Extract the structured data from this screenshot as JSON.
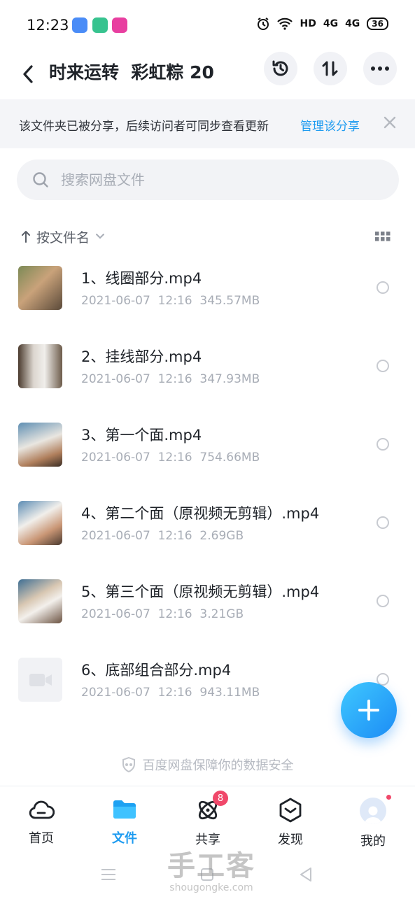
{
  "status_bar": {
    "time": "12:23",
    "network": "HD",
    "signal1": "4G",
    "signal2": "4G",
    "battery": "36",
    "app_icon_colors": [
      "#4a8cf7",
      "#37c38f",
      "#e83fa0"
    ]
  },
  "header": {
    "title": "时来运转  彩虹粽 20"
  },
  "banner": {
    "text": "该文件夹已被分享，后续访问者可同步查看更新",
    "link": "管理该分享"
  },
  "search": {
    "placeholder": "搜索网盘文件"
  },
  "sort": {
    "label": "按文件名"
  },
  "files": [
    {
      "name": "1、线圈部分.mp4",
      "date": "2021-06-07",
      "time": "12:16",
      "size": "345.57MB",
      "thumb": "video"
    },
    {
      "name": "2、挂线部分.mp4",
      "date": "2021-06-07",
      "time": "12:16",
      "size": "347.93MB",
      "thumb": "video"
    },
    {
      "name": "3、第一个面.mp4",
      "date": "2021-06-07",
      "time": "12:16",
      "size": "754.66MB",
      "thumb": "video"
    },
    {
      "name": "4、第二个面（原视频无剪辑）.mp4",
      "date": "2021-06-07",
      "time": "12:16",
      "size": "2.69GB",
      "thumb": "video"
    },
    {
      "name": "5、第三个面（原视频无剪辑）.mp4",
      "date": "2021-06-07",
      "time": "12:16",
      "size": "3.21GB",
      "thumb": "video"
    },
    {
      "name": "6、底部组合部分.mp4",
      "date": "2021-06-07",
      "time": "12:16",
      "size": "943.11MB",
      "thumb": "placeholder"
    }
  ],
  "safety_note": "百度网盘保障你的数据安全",
  "nav": {
    "items": [
      {
        "label": "首页"
      },
      {
        "label": "文件"
      },
      {
        "label": "共享",
        "badge": "8"
      },
      {
        "label": "发现"
      },
      {
        "label": "我的"
      }
    ],
    "active_color": "#1d9bf0"
  },
  "watermark": {
    "brand": "手工客",
    "url": "shougongke.com"
  }
}
